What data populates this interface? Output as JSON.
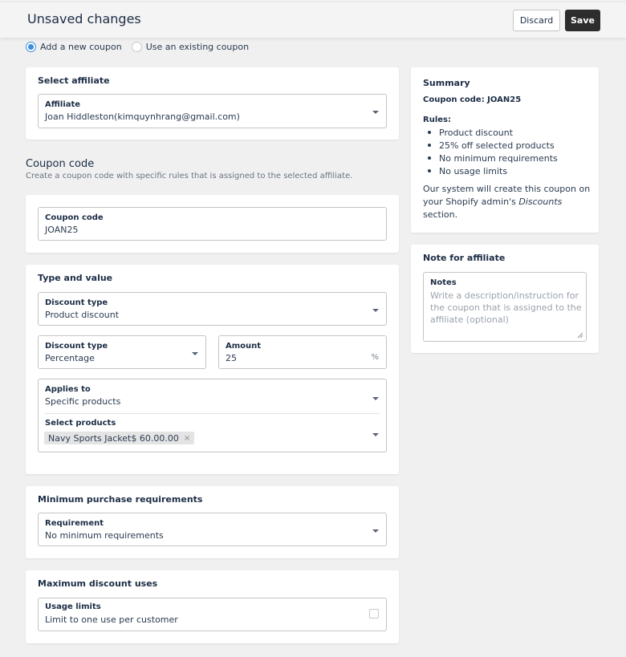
{
  "topbar": {
    "title": "Unsaved changes",
    "discard_label": "Discard",
    "save_label": "Save"
  },
  "coupon_mode": {
    "options": [
      {
        "label": "Add a new coupon",
        "checked": true
      },
      {
        "label": "Use an existing coupon",
        "checked": false
      }
    ]
  },
  "select_affiliate": {
    "title": "Select affiliate",
    "field_label": "Affiliate",
    "value": "Joan Hiddleston(kimquynhrang@gmail.com)"
  },
  "coupon_section": {
    "heading": "Coupon code",
    "description": "Create a coupon code with specific rules that is assigned to the selected affiliate.",
    "field_label": "Coupon code",
    "value": "JOAN25"
  },
  "type_and_value": {
    "title": "Type and value",
    "discount_type": {
      "label": "Discount type",
      "value": "Product discount"
    },
    "value_type": {
      "label": "Discount type",
      "value": "Percentage"
    },
    "amount": {
      "label": "Amount",
      "value": "25",
      "suffix": "%"
    },
    "applies_to": {
      "label": "Applies to",
      "value": "Specific products"
    },
    "select_products": {
      "label": "Select products",
      "selected": [
        "Navy Sports Jacket$ 60.00.00"
      ],
      "remove_glyph": "×"
    }
  },
  "minimum_purchase": {
    "title": "Minimum purchase requirements",
    "field_label": "Requirement",
    "value": "No minimum requirements"
  },
  "maximum_uses": {
    "title": "Maximum discount uses",
    "field_label": "Usage limits",
    "value": "Limit to one use per customer",
    "checked": false
  },
  "summary": {
    "title": "Summary",
    "coupon_code": "Coupon code: JOAN25",
    "rules_label": "Rules:",
    "rules": [
      "Product discount",
      "25% off selected products",
      "No minimum requirements",
      "No usage limits"
    ],
    "note_prefix": "Our system will create this coupon on your Shopify admin's ",
    "note_emphasis": "Discounts",
    "note_suffix": " section."
  },
  "note_for_affiliate": {
    "title": "Note for affiliate",
    "field_label": "Notes",
    "placeholder": "Write a description/instruction for the coupon that is assigned to the affiliate (optional)"
  },
  "colors": {
    "accent": "#3b8fd9",
    "save_button": "#2d2d2d",
    "background": "#f0f0f0"
  }
}
